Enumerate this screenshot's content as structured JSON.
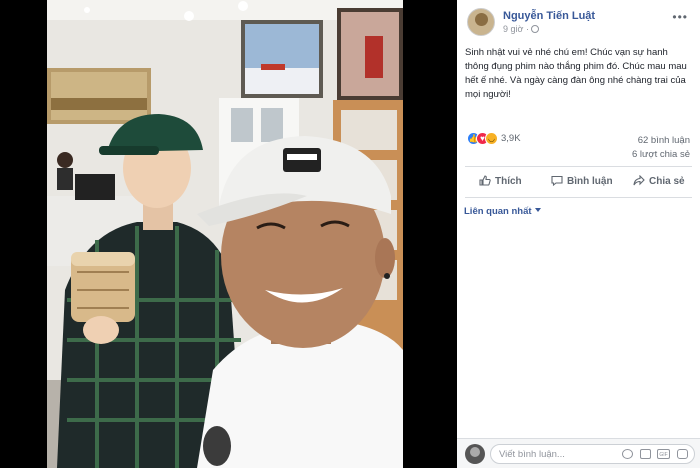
{
  "post": {
    "author": "Nguyễn Tiến Luật",
    "time": "9 giờ",
    "text": "Sinh nhật vui vẻ nhé chú em! Chúc vạn sự hanh thông đụng phim nào thắng phim đó. Chúc mau mau hết ế nhé. Và ngày càng đàn ông nhé chàng trai của mọi người!",
    "more_icon": "more-horizontal-icon",
    "privacy_icon": "globe-icon"
  },
  "stats": {
    "reactions_count": "3,9K",
    "comments": "62 bình luận",
    "shares": "6 lượt chia sẻ",
    "reaction_icons": [
      "like-icon",
      "love-icon",
      "haha-icon"
    ]
  },
  "actions": {
    "like": "Thích",
    "comment": "Bình luận",
    "share": "Chia sẻ"
  },
  "comments": {
    "sort_label": "Liên quan nhất"
  },
  "composer": {
    "placeholder": "Viết bình luận...",
    "icons": [
      "emoji-icon",
      "camera-icon",
      "gif-icon",
      "sticker-icon"
    ]
  },
  "colors": {
    "link": "#385898",
    "muted": "#90949c",
    "like_blue": "#2d7ff9",
    "love_red": "#f0284a",
    "haha_yellow": "#f7b125"
  }
}
